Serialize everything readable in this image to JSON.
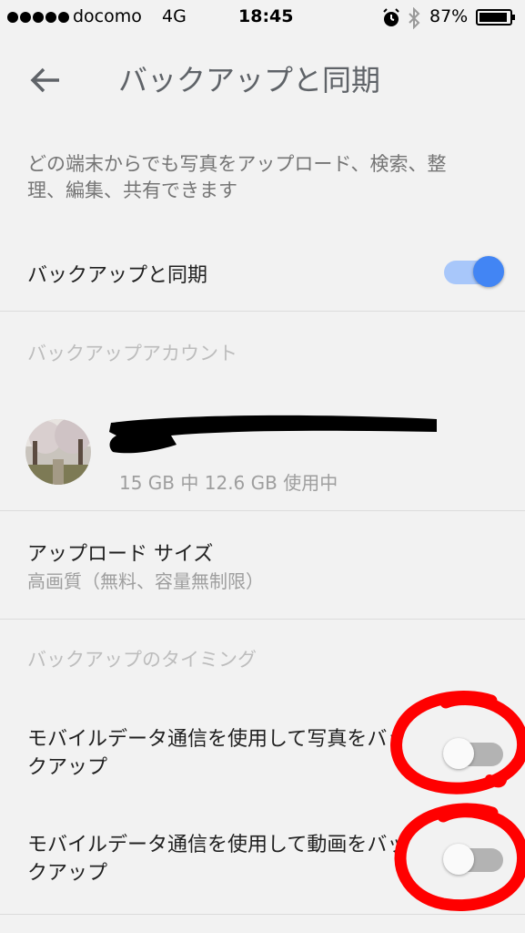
{
  "status_bar": {
    "carrier": "docomo",
    "network": "4G",
    "time": "18:45",
    "battery": "87%"
  },
  "header": {
    "title": "バックアップと同期"
  },
  "description": "どの端末からでも写真をアップロード、検索、整理、編集、共有できます",
  "backup_sync": {
    "label": "バックアップと同期",
    "enabled": true
  },
  "account_section": {
    "heading": "バックアップアカウント",
    "storage": "15 GB 中 12.6 GB 使用中"
  },
  "upload_size": {
    "label": "アップロード サイズ",
    "value": "高画質（無料、容量無制限）"
  },
  "timing_section": {
    "heading": "バックアップのタイミング",
    "photos_mobile_label": "モバイルデータ通信を使用して写真をバックアップ",
    "photos_mobile_enabled": false,
    "videos_mobile_label": "モバイルデータ通信を使用して動画をバックアップ",
    "videos_mobile_enabled": false
  },
  "colors": {
    "accent": "#4285f4",
    "annotation": "#ff0000"
  }
}
